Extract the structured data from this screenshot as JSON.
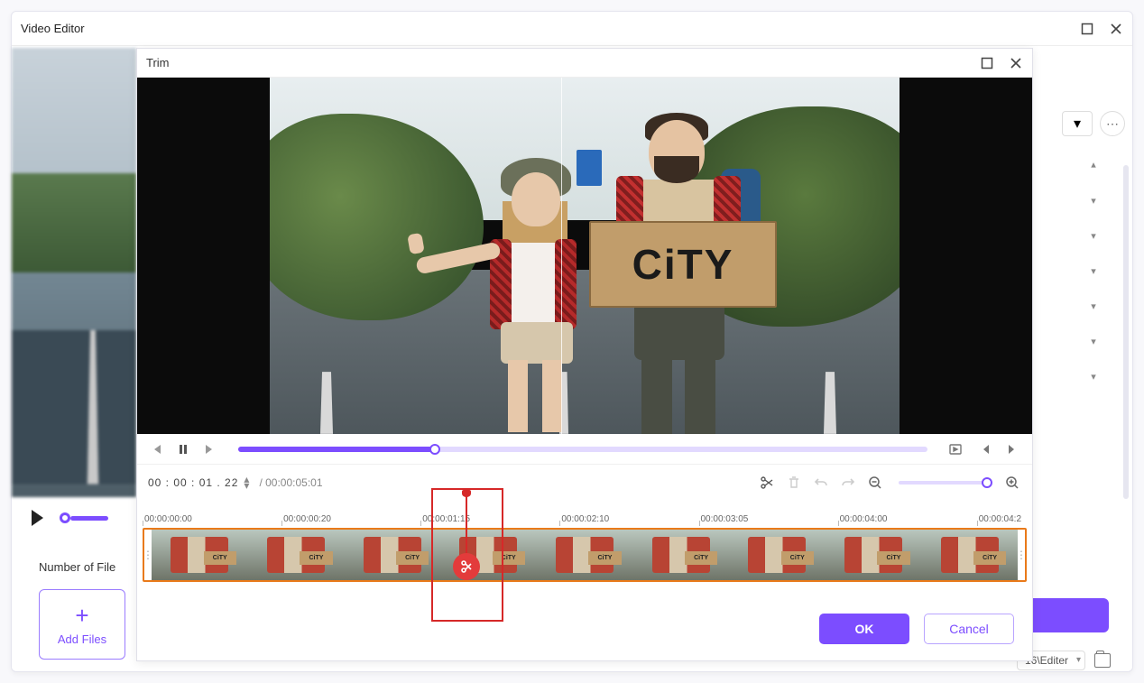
{
  "outer": {
    "title": "Video Editor",
    "number_of_files_label": "Number of File",
    "add_files_label": "Add Files",
    "output_path": "16\\Editer"
  },
  "trim": {
    "title": "Trim",
    "timecode": "00 : 00 : 01 . 22",
    "duration": "/ 00:00:05:01",
    "ruler_ticks": [
      "00:00:00:00",
      "00:00:00:20",
      "00:00:01:15",
      "00:00:02:10",
      "00:00:03:05",
      "00:00:04:00",
      "00:00:04:2"
    ],
    "sign_text": "CiTY",
    "thumb_sign": "CiTY",
    "ok_label": "OK",
    "cancel_label": "Cancel",
    "progress_percent": 28.5,
    "playhead_percent": 32.6
  }
}
